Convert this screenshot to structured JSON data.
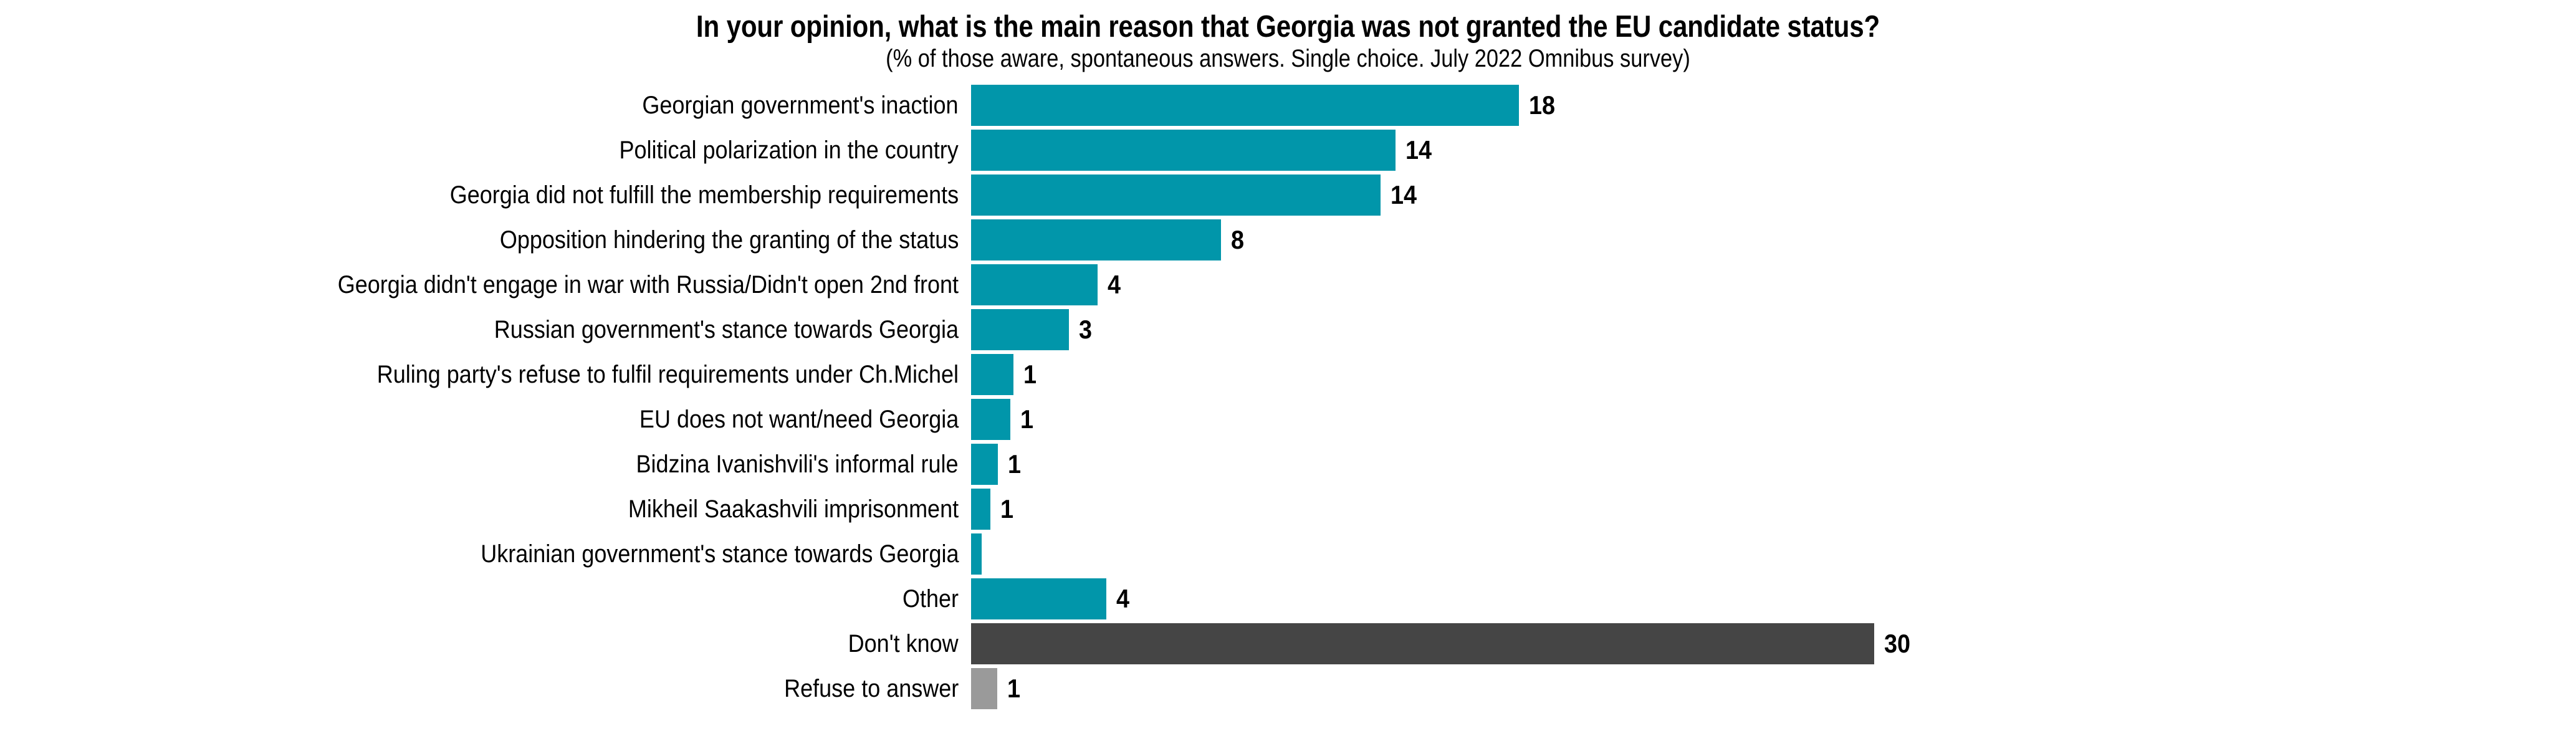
{
  "header": {
    "title": "In your opinion, what is the main reason that Georgia was not granted the EU candidate status?",
    "subtitle": "(% of those aware, spontaneous answers. Single choice. July 2022 Omnibus survey)"
  },
  "colors": {
    "bar_teal": "#0196AA",
    "bar_dark": "#454545",
    "bar_grey": "#9A9A9A",
    "text": "#000000",
    "background": "#FFFFFF"
  },
  "chart_data": {
    "type": "bar",
    "orientation": "horizontal",
    "title": "In your opinion, what is the main reason that Georgia was not granted the EU candidate status?",
    "subtitle": "(% of those aware, spontaneous answers. Single choice. July 2022 Omnibus survey)",
    "xlabel": "",
    "ylabel": "",
    "xlim": [
      0,
      32
    ],
    "grid": false,
    "legend": false,
    "axis_visible": false,
    "value_unit": "%",
    "categories": [
      "Georgian government's inaction",
      "Political polarization in the country",
      "Georgia did not fulfill the membership requirements",
      "Opposition hindering the granting of the status",
      "Georgia didn't engage in war with Russia/Didn't open 2nd front",
      "Russian government's stance towards Georgia",
      "Ruling party's refuse to fulfil requirements under Ch.Michel",
      "EU does not want/need Georgia",
      "Bidzina Ivanishvili's informal rule",
      "Mikheil Saakashvili imprisonment",
      "Ukrainian government's stance towards Georgia",
      "Other",
      "Don't know",
      "Refuse to answer"
    ],
    "values": [
      18,
      14,
      14,
      8,
      4,
      3,
      1,
      1,
      1,
      1,
      0,
      4,
      30,
      1
    ],
    "labels": [
      "18",
      "14",
      "14",
      "8",
      "4",
      "3",
      "1",
      "1",
      "1",
      "1",
      "",
      "4",
      "30",
      "1"
    ],
    "bar_lengths_units": [
      18.2,
      14.1,
      13.6,
      8.3,
      4.2,
      3.25,
      1.4,
      1.3,
      0.9,
      0.65,
      0.35,
      4.5,
      30.0,
      0.87
    ],
    "bar_colors": [
      "#0196AA",
      "#0196AA",
      "#0196AA",
      "#0196AA",
      "#0196AA",
      "#0196AA",
      "#0196AA",
      "#0196AA",
      "#0196AA",
      "#0196AA",
      "#0196AA",
      "#0196AA",
      "#454545",
      "#9A9A9A"
    ]
  }
}
